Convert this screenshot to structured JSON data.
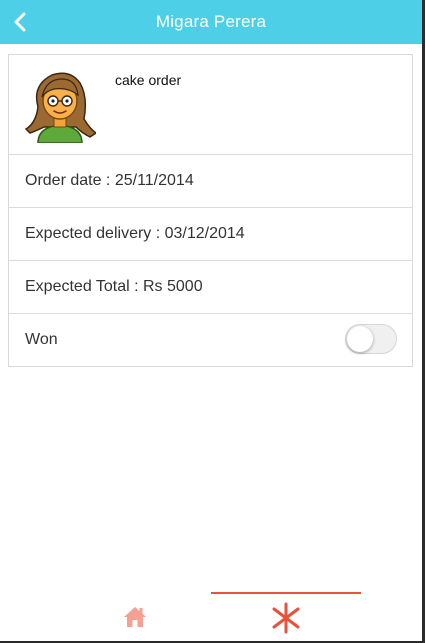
{
  "header": {
    "title": "Migara Perera",
    "back_icon": "chevron-left-icon"
  },
  "order": {
    "avatar_icon": "girl-avatar-icon",
    "item_name": "cake order",
    "order_date": "Order date : 25/11/2014",
    "expected_delivery": "Expected delivery : 03/12/2014",
    "expected_total": "Expected Total : Rs 5000",
    "won_label": "Won",
    "won_toggle_on": false
  },
  "tabs": [
    {
      "icon": "home-icon",
      "active": false
    },
    {
      "icon": "asterisk-icon",
      "active": true
    }
  ],
  "colors": {
    "header_bg": "#4dcfe8",
    "tab_accent": "#e8513a",
    "home_icon": "#f4a093"
  }
}
